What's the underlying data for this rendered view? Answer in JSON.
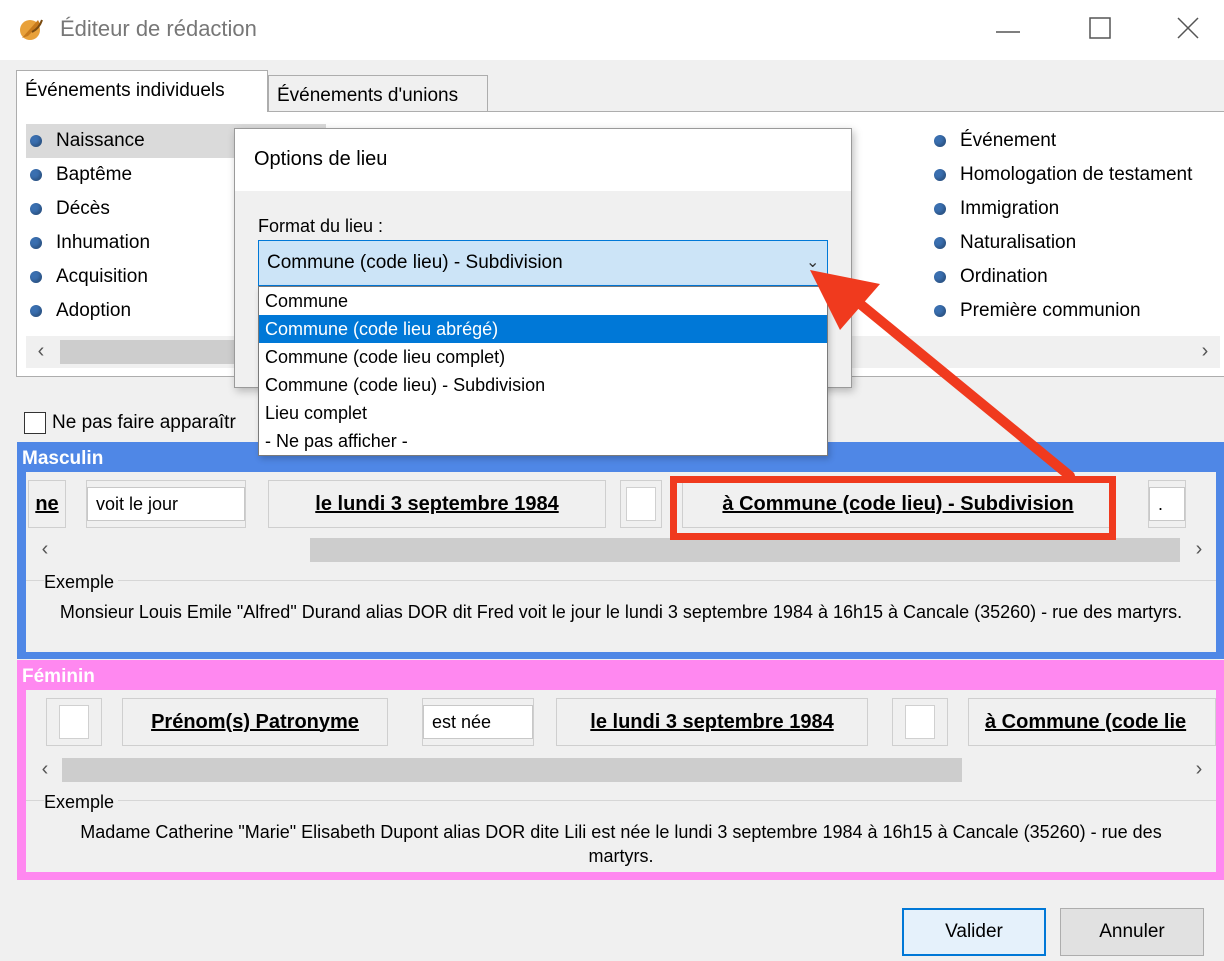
{
  "window": {
    "title": "Éditeur de rédaction"
  },
  "tabs": [
    {
      "label": "Événements individuels"
    },
    {
      "label": "Événements d'unions"
    }
  ],
  "events": {
    "left": [
      "Naissance",
      "Baptême",
      "Décès",
      "Inhumation",
      "Acquisition",
      "Adoption"
    ],
    "right": [
      "Événement",
      "Homologation de testament",
      "Immigration",
      "Naturalisation",
      "Ordination",
      "Première communion"
    ]
  },
  "hide_option": {
    "label": "Ne pas faire apparaîtr"
  },
  "masculin": {
    "title": "Masculin",
    "chips": {
      "partial": "ne",
      "verb": "voit le jour",
      "date": "le lundi 3 septembre 1984",
      "place": "à Commune (code lieu) - Subdivision",
      "end": "."
    },
    "example_label": "Exemple",
    "example_text": "Monsieur Louis Emile \"Alfred\" Durand alias DOR dit Fred voit le jour le lundi 3 septembre 1984 à 16h15 à Cancale (35260) - rue des martyrs."
  },
  "feminin": {
    "title": "Féminin",
    "chips": {
      "name": "Prénom(s) Patronyme",
      "verb": "est née",
      "date": "le lundi 3 septembre 1984",
      "place": "à Commune (code lie"
    },
    "example_label": "Exemple",
    "example_text": "Madame Catherine \"Marie\" Elisabeth Dupont alias DOR dite Lili est née le lundi 3 septembre 1984 à 16h15 à Cancale (35260) - rue des martyrs."
  },
  "dialog": {
    "title": "Options de lieu",
    "format_label": "Format du lieu :",
    "selected": "Commune (code lieu) - Subdivision",
    "options": [
      "Commune",
      "Commune (code lieu abrégé)",
      "Commune (code lieu complet)",
      "Commune (code lieu) - Subdivision",
      "Lieu complet",
      "- Ne pas afficher -"
    ],
    "highlighted_option_index": 1
  },
  "buttons": {
    "validate": "Valider",
    "cancel": "Annuler"
  },
  "colors": {
    "masculin": "#4f87e6",
    "feminin": "#ff88f0",
    "annotation": "#f03a1e",
    "selection": "#0078d7"
  }
}
